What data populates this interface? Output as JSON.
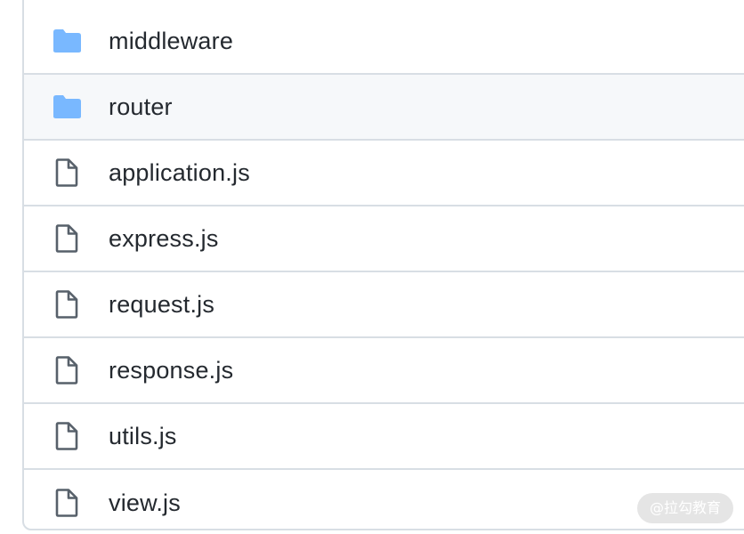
{
  "file_list": {
    "items": [
      {
        "name": "middleware",
        "type": "folder",
        "icon": "folder-icon"
      },
      {
        "name": "router",
        "type": "folder",
        "icon": "folder-icon"
      },
      {
        "name": "application.js",
        "type": "file",
        "icon": "file-icon"
      },
      {
        "name": "express.js",
        "type": "file",
        "icon": "file-icon"
      },
      {
        "name": "request.js",
        "type": "file",
        "icon": "file-icon"
      },
      {
        "name": "response.js",
        "type": "file",
        "icon": "file-icon"
      },
      {
        "name": "utils.js",
        "type": "file",
        "icon": "file-icon"
      },
      {
        "name": "view.js",
        "type": "file",
        "icon": "file-icon"
      }
    ]
  },
  "colors": {
    "folder": "#54aeff",
    "file_icon": "#57606a",
    "text": "#24292f",
    "border": "#d8dee4",
    "hover_row": "#f6f8fa"
  },
  "watermark": {
    "text": "@拉勾教育"
  }
}
